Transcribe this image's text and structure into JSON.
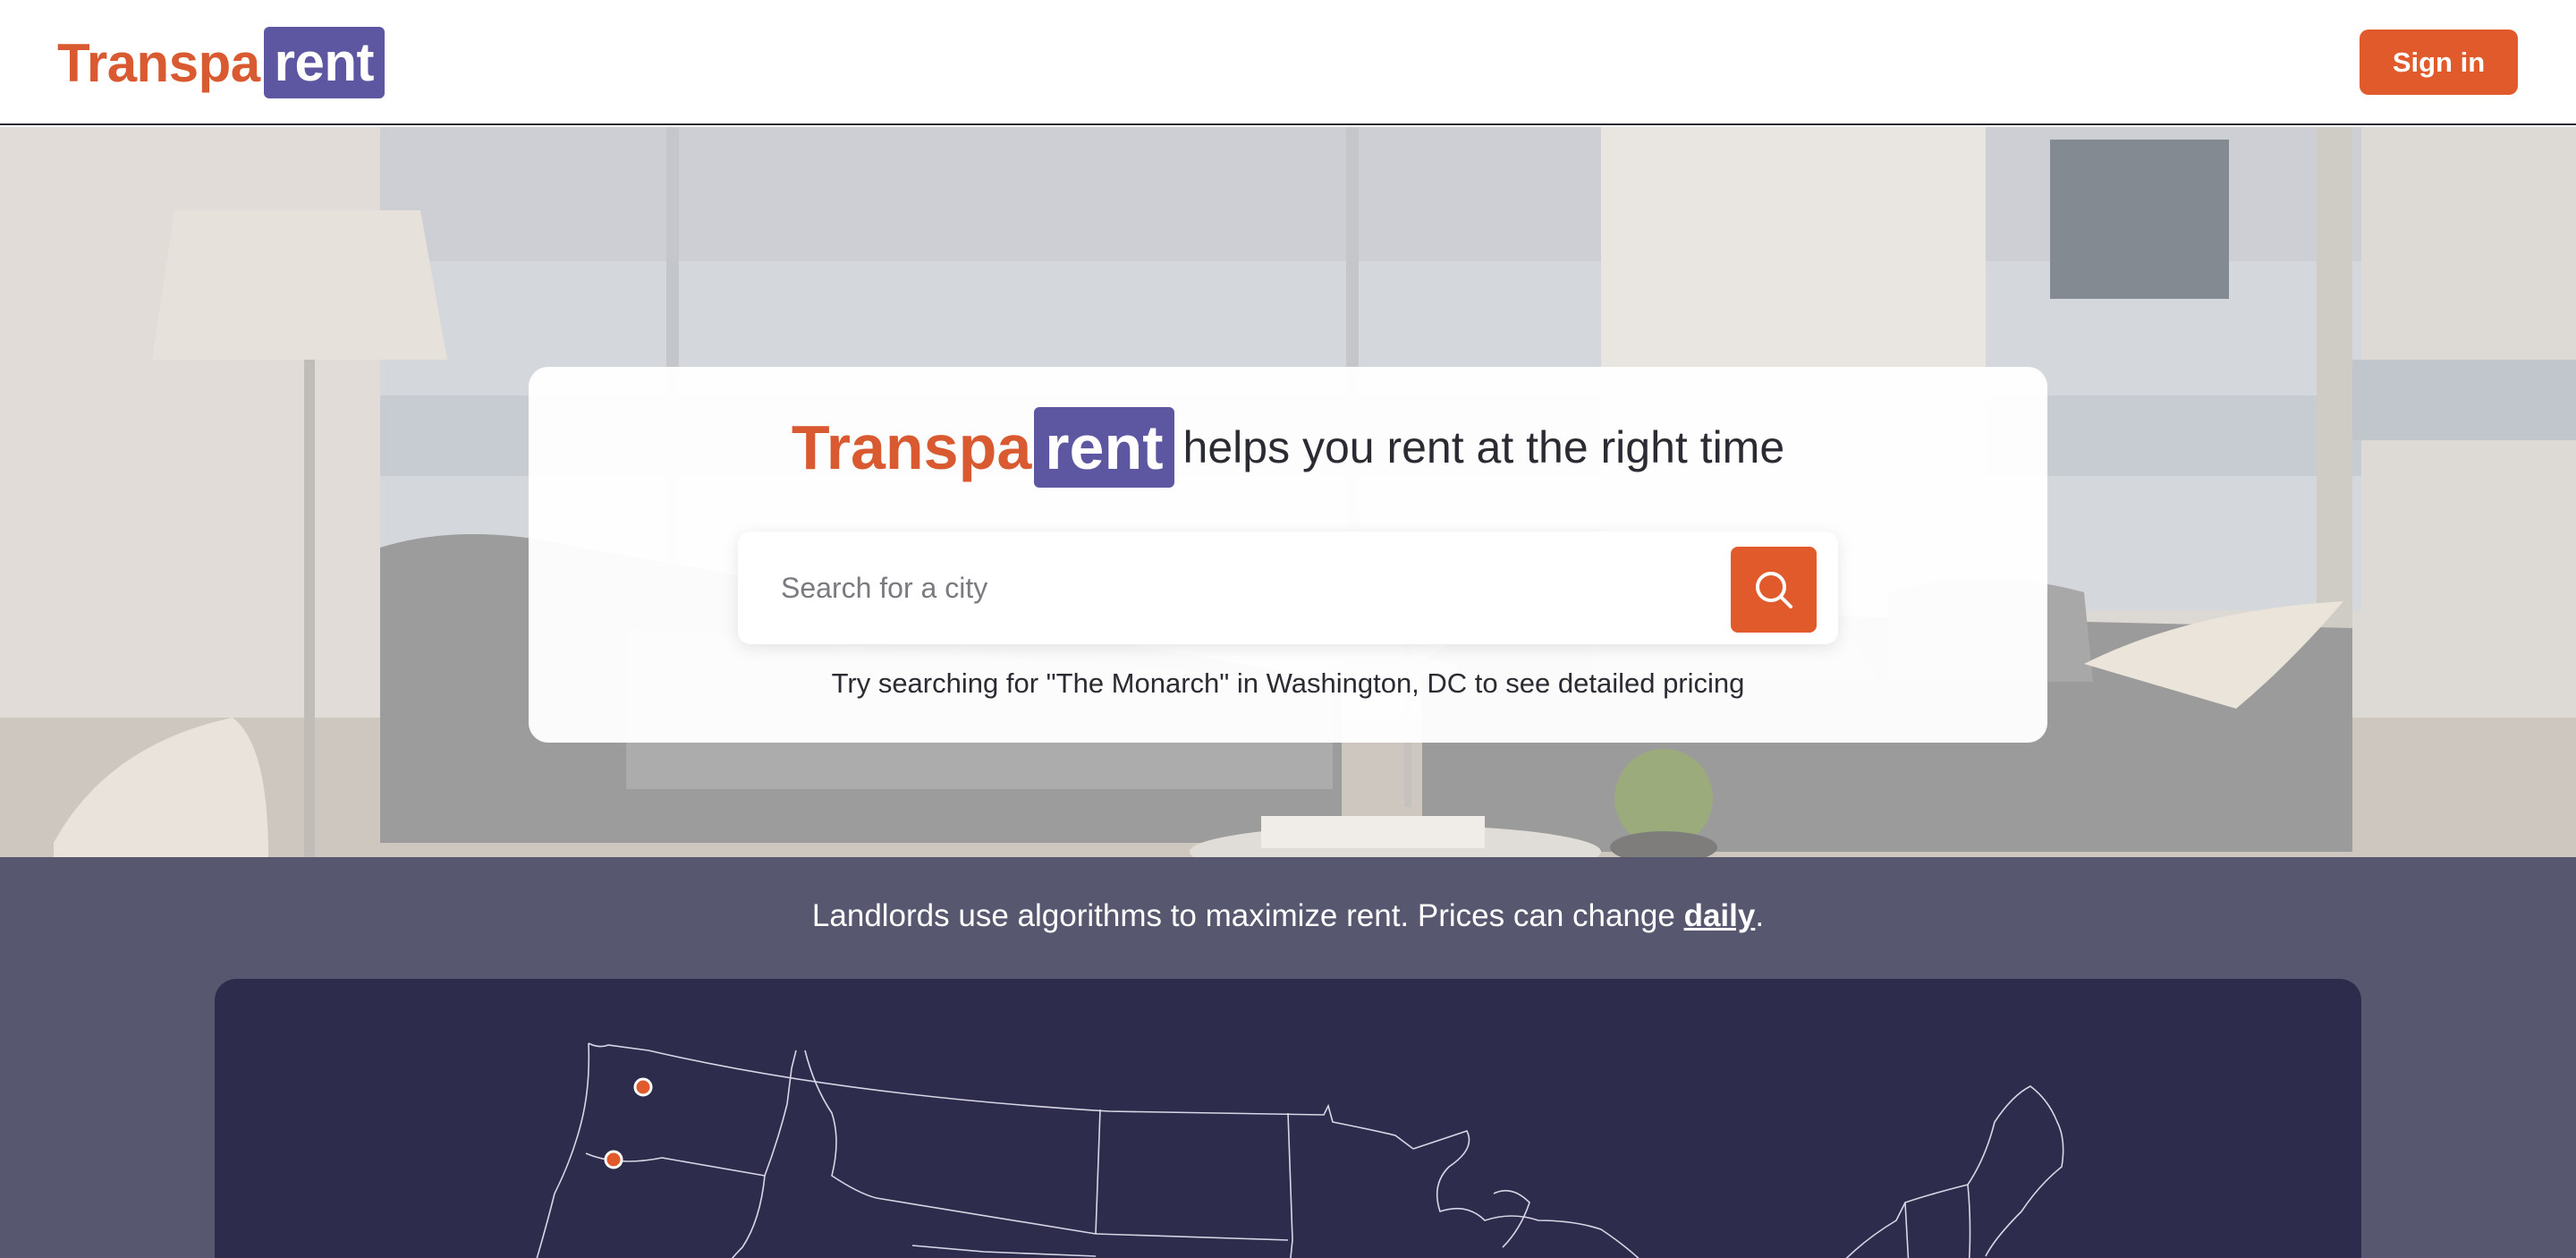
{
  "brand": {
    "part1": "Transpa",
    "part2": "rent"
  },
  "header": {
    "signin_label": "Sign in"
  },
  "hero": {
    "tagline": "helps you rent at the right time",
    "search_placeholder": "Search for a city",
    "hint": "Try searching for \"The Monarch\" in Washington, DC to see detailed pricing"
  },
  "map_section": {
    "headline_text": "Landlords use algorithms to maximize rent. Prices can change ",
    "headline_emphasis": "daily",
    "headline_end": "."
  },
  "colors": {
    "brand_orange": "#e05a2b",
    "brand_purple": "#5d56a1",
    "map_background": "#2e2c4c",
    "section_background": "#575870"
  },
  "icons": {
    "search": "search-icon",
    "map_marker": "map-marker-icon"
  }
}
